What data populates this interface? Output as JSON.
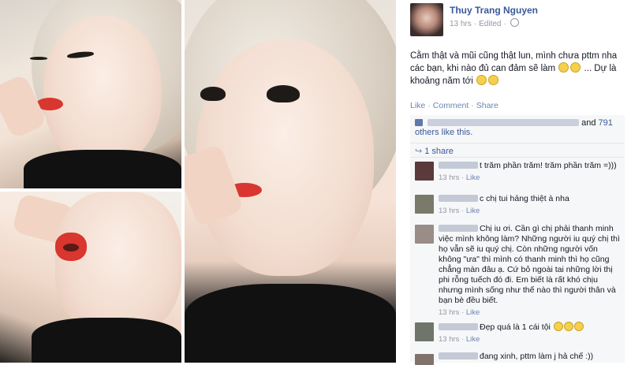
{
  "post": {
    "author": "Thuy Trang Nguyen",
    "time": "13 hrs",
    "edited": "Edited",
    "text": "Cằm thật và mũi cũng thật lun, mình chưa pttm nha các bạn, khi nào đủ can đảm sẽ làm",
    "text_tail": "... Dự là khoảng năm tới",
    "actions": [
      "Like",
      "Comment",
      "Share"
    ]
  },
  "likes": {
    "and": "and",
    "count": "791",
    "others": "others like this."
  },
  "shares": {
    "label": "1 share"
  },
  "comments": [
    {
      "text": "t trăm phần trăm! trăm phần trăm =)))",
      "time": "13 hrs",
      "like": "Like"
    },
    {
      "text": "c chị tui hảng thiệt à nha",
      "time": "13 hrs",
      "like": "Like"
    },
    {
      "text": "Chị iu ơi. Cần gì chị phải thanh minh việc mình không làm? Những người iu quý chị thì họ vẫn sẽ iu quý chị. Còn những người vốn không \"ưa\" thì mình có thanh minh thì họ cũng chẳng màn đâu ạ. Cứ bỏ ngoài tai những lời thị phi rỗng tuếch đó đi. Em biết là rất khó chịu nhưng mình sống như thế nào thì người thân và bạn bè đều biết.",
      "time": "13 hrs",
      "like": "Like"
    },
    {
      "text": "Đẹp quá là 1 cái tội",
      "time": "13 hrs",
      "like": "Like"
    },
    {
      "text": "đang xinh, pttm làm j hả chế :))"
    }
  ],
  "colors": {
    "link": "#3b5998",
    "meta": "#9197a3",
    "ufi_bg": "#f6f7f8",
    "lipstick": "#d8362e"
  }
}
